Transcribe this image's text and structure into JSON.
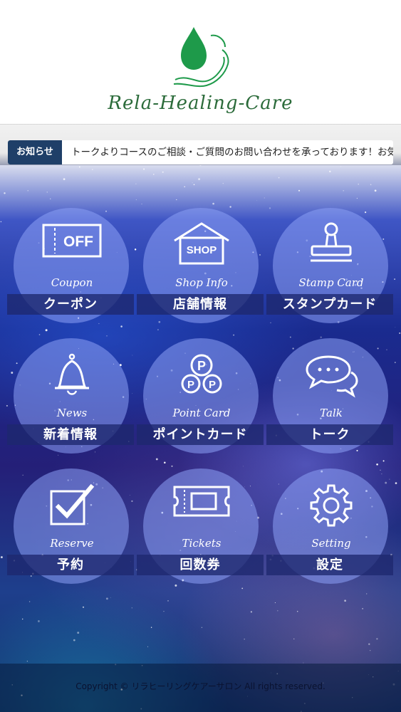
{
  "app": {
    "logo_text": "Rela-Healing-Care"
  },
  "news": {
    "label": "お知らせ",
    "text": "トークよりコースのご相談・ご質問のお問い合わせを承っております！お気"
  },
  "menu": [
    {
      "en": "Coupon",
      "jp": "クーポン",
      "icon": "coupon-off-icon"
    },
    {
      "en": "Shop Info",
      "jp": "店舗情報",
      "icon": "shop-icon"
    },
    {
      "en": "Stamp Card",
      "jp": "スタンプカード",
      "icon": "stamp-icon"
    },
    {
      "en": "News",
      "jp": "新着情報",
      "icon": "bell-icon"
    },
    {
      "en": "Point Card",
      "jp": "ポイントカード",
      "icon": "point-coins-icon"
    },
    {
      "en": "Talk",
      "jp": "トーク",
      "icon": "chat-bubbles-icon"
    },
    {
      "en": "Reserve",
      "jp": "予約",
      "icon": "checkbox-icon"
    },
    {
      "en": "Tickets",
      "jp": "回数券",
      "icon": "ticket-icon"
    },
    {
      "en": "Setting",
      "jp": "設定",
      "icon": "gear-icon"
    }
  ],
  "icon_labels": {
    "off": "OFF",
    "shop": "SHOP",
    "point": "P"
  },
  "footer": {
    "copyright": "Copyright © リラヒーリングケアーサロン All rights reserved."
  },
  "colors": {
    "news_label_bg": "#1f3f68",
    "logo_green": "#1e9a4a"
  }
}
